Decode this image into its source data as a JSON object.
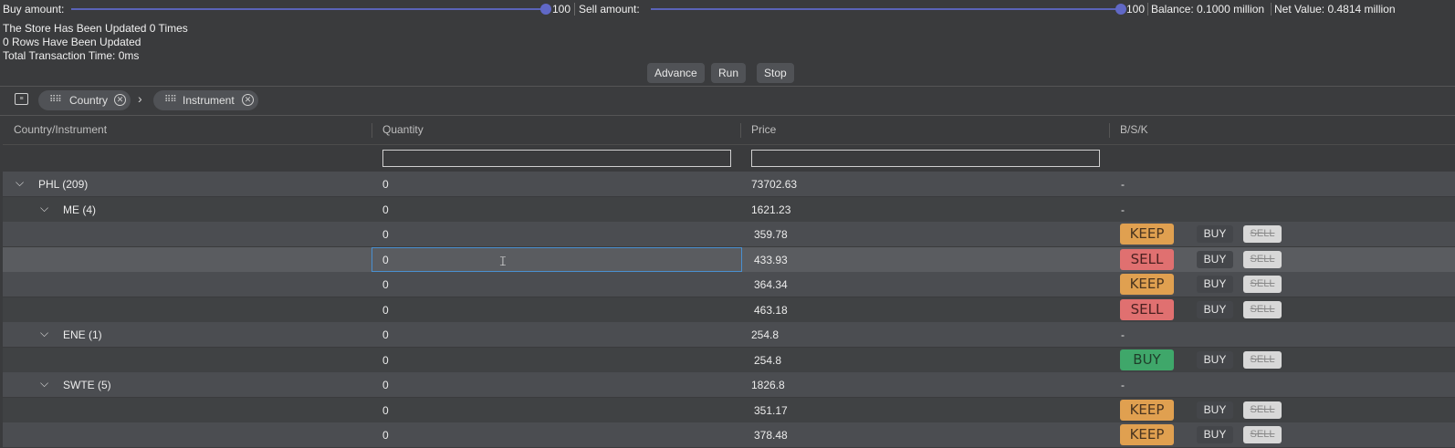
{
  "controls": {
    "buy_label": "Buy amount:",
    "buy_value": "100",
    "sell_label": "Sell amount:",
    "sell_value": "100",
    "balance": "Balance: 0.1000 million",
    "net_value": "Net Value: 0.4814 million"
  },
  "info": {
    "line1": "The Store Has Been Updated 0 Times",
    "line2": "0 Rows Have Been Updated",
    "line3": "Total Transaction Time: 0ms"
  },
  "actions": {
    "advance": "Advance",
    "run": "Run",
    "stop": "Stop"
  },
  "grouping": {
    "chips": [
      "Country",
      "Instrument"
    ],
    "separator": "›"
  },
  "columns": [
    "Country/Instrument",
    "Quantity",
    "Price",
    "B/S/K"
  ],
  "rows": [
    {
      "type": "group",
      "level": 0,
      "label": "PHL (209)",
      "qty": "0",
      "price": "73702.63",
      "bsk": "-"
    },
    {
      "type": "group",
      "level": 1,
      "label": "ME (4)",
      "qty": "0",
      "price": "1621.23",
      "bsk": "-"
    },
    {
      "type": "leaf",
      "qty": "0",
      "price": "359.78",
      "badge": "KEEP",
      "buy": "BUY",
      "sell": "SELL"
    },
    {
      "type": "leaf",
      "qty": "0",
      "price": "433.93",
      "badge": "SELL",
      "buy": "BUY",
      "sell": "SELL",
      "selected": true
    },
    {
      "type": "leaf",
      "qty": "0",
      "price": "364.34",
      "badge": "KEEP",
      "buy": "BUY",
      "sell": "SELL"
    },
    {
      "type": "leaf",
      "qty": "0",
      "price": "463.18",
      "badge": "SELL",
      "buy": "BUY",
      "sell": "SELL"
    },
    {
      "type": "group",
      "level": 1,
      "label": "ENE (1)",
      "qty": "0",
      "price": "254.8",
      "bsk": "-"
    },
    {
      "type": "leaf",
      "qty": "0",
      "price": "254.8",
      "badge": "BUY",
      "buy": "BUY",
      "sell": "SELL"
    },
    {
      "type": "group",
      "level": 1,
      "label": "SWTE (5)",
      "qty": "0",
      "price": "1826.8",
      "bsk": "-"
    },
    {
      "type": "leaf",
      "qty": "0",
      "price": "351.17",
      "badge": "KEEP",
      "buy": "BUY",
      "sell": "SELL"
    },
    {
      "type": "leaf",
      "qty": "0",
      "price": "378.48",
      "badge": "KEEP",
      "buy": "BUY",
      "sell": "SELL"
    }
  ],
  "colors": {
    "accent": "#5a63b8",
    "keep": "#e0a050",
    "sell": "#e07070",
    "buy": "#3fa76a"
  },
  "icons": {
    "expanded": "chevron-down-icon",
    "group_panel": "group-panel-icon",
    "remove": "close-circle-icon",
    "drag": "drag-grip-icon"
  }
}
